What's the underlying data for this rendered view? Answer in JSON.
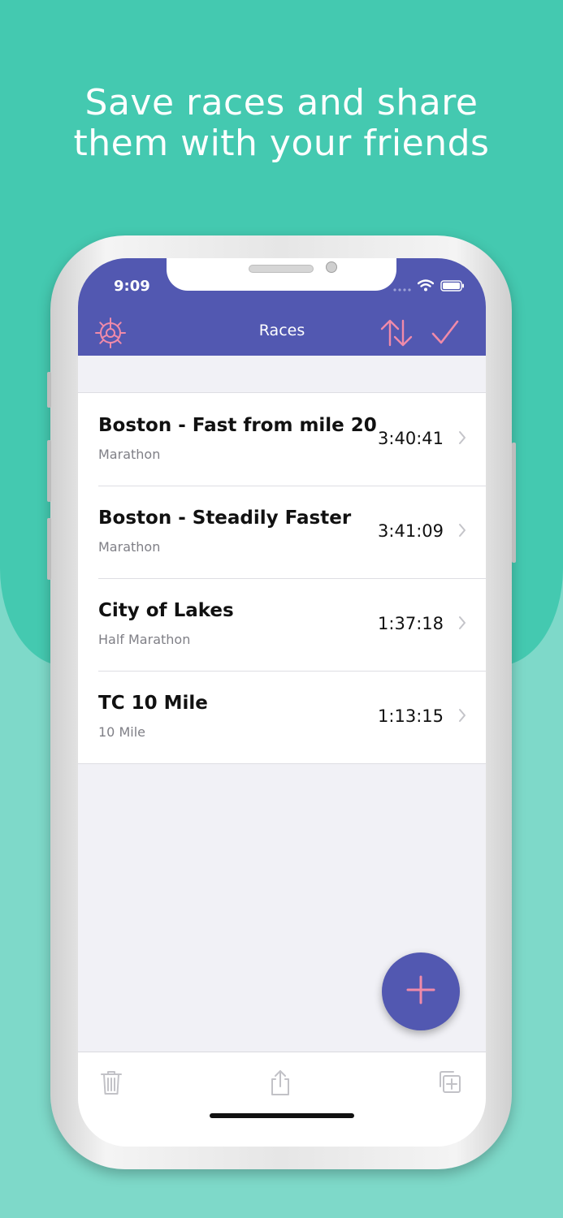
{
  "headline": {
    "line1": "Save races and share",
    "line2": "them with your friends"
  },
  "colors": {
    "background_top": "#44c9b0",
    "background_bottom": "#7ed9c9",
    "nav_bar": "#5258b1",
    "accent": "#f08aa9"
  },
  "status_bar": {
    "time": "9:09",
    "icons": [
      "signal-icon",
      "wifi-icon",
      "battery-icon"
    ]
  },
  "nav": {
    "title": "Races",
    "left_icon": "gear-icon",
    "right_icons": [
      "sort-icon",
      "checkmark-icon"
    ]
  },
  "races": [
    {
      "name": "Boston - Fast from mile 20",
      "type": "Marathon",
      "time": "3:40:41"
    },
    {
      "name": "Boston - Steadily Faster",
      "type": "Marathon",
      "time": "3:41:09"
    },
    {
      "name": "City of Lakes",
      "type": "Half Marathon",
      "time": "1:37:18"
    },
    {
      "name": "TC 10 Mile",
      "type": "10 Mile",
      "time": "1:13:15"
    }
  ],
  "fab": {
    "icon": "plus-icon"
  },
  "toolbar": {
    "icons": [
      "trash-icon",
      "share-icon",
      "duplicate-icon"
    ]
  }
}
